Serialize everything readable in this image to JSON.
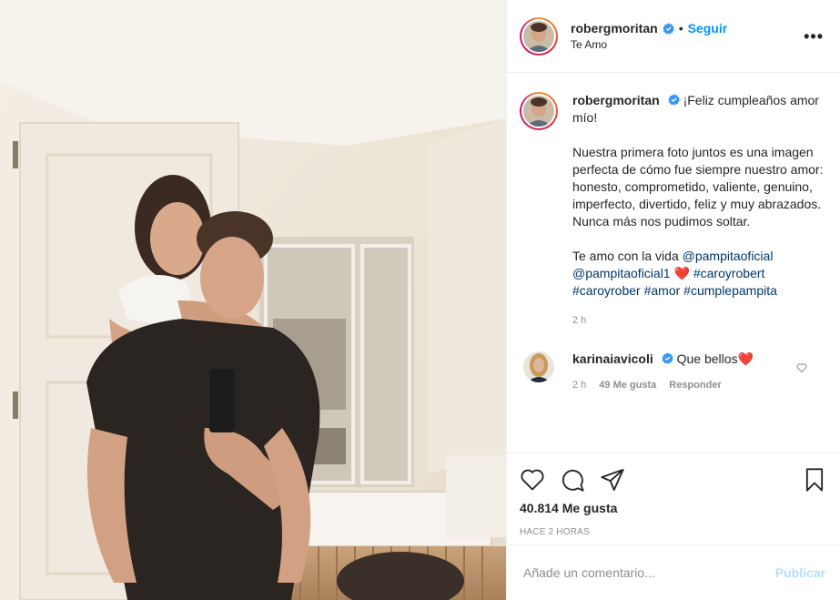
{
  "header": {
    "username": "robergmoritan",
    "separator": "•",
    "follow_label": "Seguir",
    "location": "Te Amo",
    "more_label": "•••"
  },
  "caption": {
    "username": "robergmoritan",
    "line1": "¡Feliz cumpleaños amor mío!",
    "line2": "Nuestra primera foto juntos es una imagen perfecta de cómo fue siempre nuestro amor: honesto, comprometido, valiente, genuino, imperfecto, divertido, feliz y muy abrazados. Nunca más nos pudimos soltar.",
    "line3_text": "Te amo con la vida ",
    "mention1": "@pampitaoficial",
    "mention2": "@pampitaoficial1",
    "emoji": "❤️",
    "hashtags": [
      "#caroyrobert",
      "#caroyrober",
      "#amor",
      "#cumplepampita"
    ],
    "time": "2 h"
  },
  "comment": {
    "username": "karinaiavicoli",
    "text": "Que bellos",
    "emoji": "❤️",
    "time": "2 h",
    "likes": "49 Me gusta",
    "reply": "Responder"
  },
  "actions": {
    "likes": "40.814 Me gusta",
    "ago": "HACE 2 HORAS"
  },
  "add_comment": {
    "placeholder": "Añade un comentario...",
    "publish": "Publicar"
  },
  "icons": {
    "verified": "verified-badge-icon",
    "more": "more-options-icon",
    "like": "heart-icon",
    "comment": "comment-icon",
    "share": "share-icon",
    "save": "bookmark-icon"
  },
  "colors": {
    "accent": "#0095f6",
    "link": "#00376b",
    "muted": "#8e8e8e",
    "publish_disabled": "#b2dffc",
    "heart": "#ed4956"
  }
}
